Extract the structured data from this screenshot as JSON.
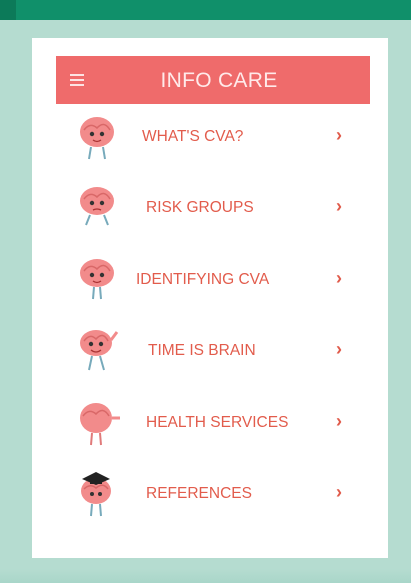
{
  "app": {
    "title": "INFO CARE"
  },
  "colors": {
    "background": "#b5dcd0",
    "status_bar": "#10906a",
    "app_bar": "#ef6b6b",
    "label": "#e25c4c",
    "brain": "#f28b8b"
  },
  "menu": {
    "items": [
      {
        "label": "WHAT'S CVA?",
        "icon": "brain-mascot-icon",
        "chevron": "›"
      },
      {
        "label": "RISK GROUPS",
        "icon": "brain-mascot-icon",
        "chevron": "›"
      },
      {
        "label": "IDENTIFYING CVA",
        "icon": "brain-mascot-icon",
        "chevron": "›"
      },
      {
        "label": "TIME IS BRAIN",
        "icon": "brain-mascot-icon",
        "chevron": "›"
      },
      {
        "label": "HEALTH SERVICES",
        "icon": "brain-mascot-icon",
        "chevron": "›"
      },
      {
        "label": "REFERENCES",
        "icon": "brain-mascot-graduate-icon",
        "chevron": "›"
      }
    ]
  }
}
